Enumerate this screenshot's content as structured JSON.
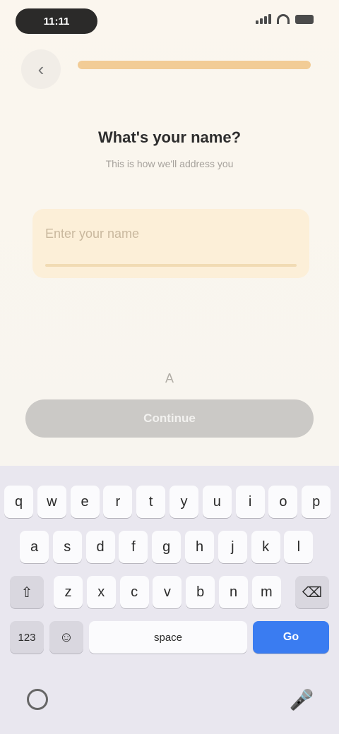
{
  "status": {
    "time": "11:11"
  },
  "header": {
    "back_icon": "chevron-left-icon",
    "progress_fraction": 1.0
  },
  "main": {
    "title": "What's your name?",
    "subtitle": "This is how we'll address you",
    "input": {
      "placeholder": "Enter your name",
      "value": ""
    },
    "hint": "A",
    "continue_label": "Continue"
  },
  "keyboard": {
    "row1": [
      "q",
      "w",
      "e",
      "r",
      "t",
      "y",
      "u",
      "i",
      "o",
      "p"
    ],
    "row2": [
      "a",
      "s",
      "d",
      "f",
      "g",
      "h",
      "j",
      "k",
      "l"
    ],
    "row3": [
      "z",
      "x",
      "c",
      "v",
      "b",
      "n",
      "m"
    ],
    "numbers_label": "123",
    "emoji_label": "☺",
    "space_label": "space",
    "go_label": "Go",
    "shift_label": "⇧",
    "delete_label": "⌫",
    "mic_label": "🎤"
  },
  "colors": {
    "accent": "#3a7cf1",
    "input_bg": "#fcefd8",
    "progress": "#f2cc96"
  }
}
